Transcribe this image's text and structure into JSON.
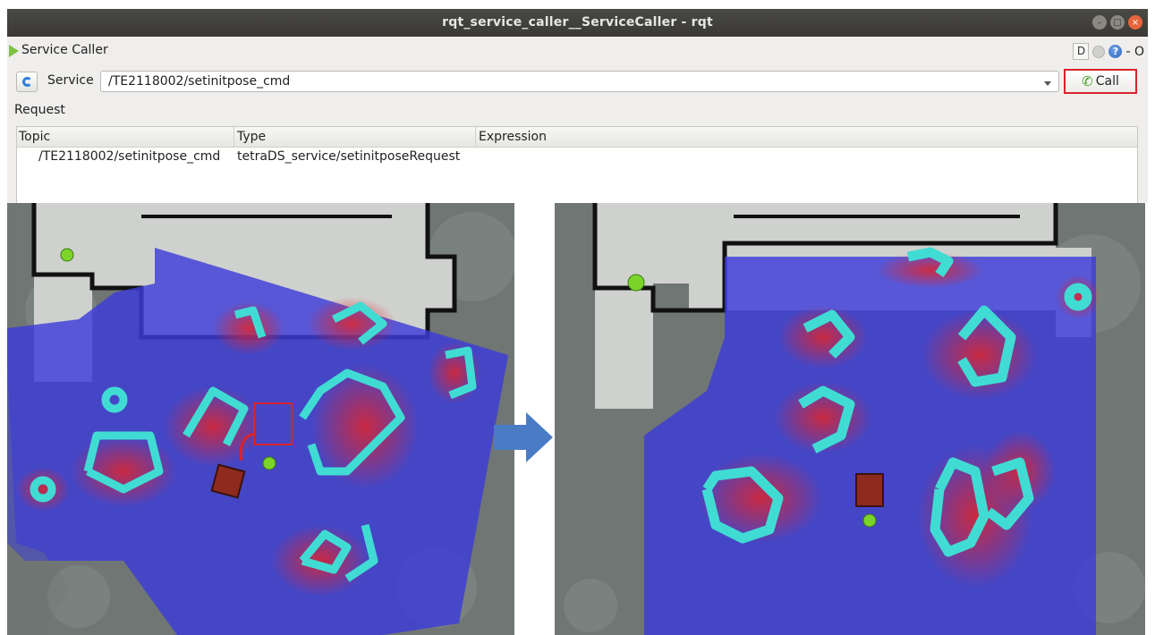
{
  "window": {
    "title": "rqt_service_caller__ServiceCaller - rqt"
  },
  "plugin": {
    "name": "Service Caller",
    "tools": {
      "d_label": "D",
      "dash_label": "- O"
    }
  },
  "service": {
    "label": "Service",
    "value": "/TE2118002/setinitpose_cmd",
    "call_label": "Call"
  },
  "request": {
    "label": "Request",
    "columns": [
      "Topic",
      "Type",
      "Expression"
    ],
    "rows": [
      {
        "topic": "/TE2118002/setinitpose_cmd",
        "type": "tetraDS_service/setinitposeRequest",
        "expression": ""
      }
    ]
  },
  "colors": {
    "call_highlight": "#d9242b",
    "costmap_blue": "#3c3cd8",
    "inflation_red": "#e0242a",
    "obstacle_cyan": "#40dcd4",
    "marker_green": "#7cd42a",
    "robot_brown": "#8e2a1e",
    "arrow_blue": "#4a7cc6"
  },
  "icons": {
    "plugin": "green-triangle-icon",
    "refresh": "refresh-icon",
    "call": "phone-icon",
    "help": "help-icon",
    "settings": "gear-icon"
  }
}
